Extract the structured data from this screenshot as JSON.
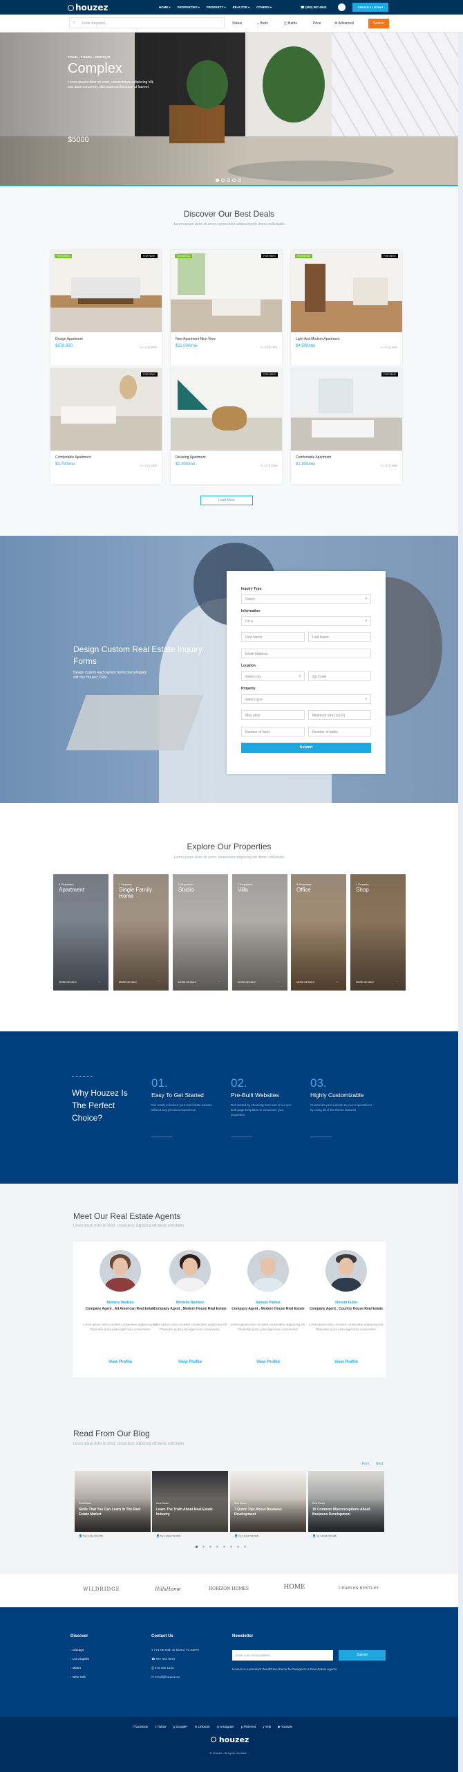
{
  "header": {
    "logo": "houzez",
    "nav": [
      "HOME",
      "PROPERTIES",
      "PROPERTY",
      "REALTOR",
      "OTHERS"
    ],
    "phone": "(800) 987 6543",
    "cta": "CREATE A LISTING",
    "search_placeholder": "Enter Keyword...",
    "filters": [
      "Status",
      "Beds",
      "Baths",
      "Price",
      "Advanced"
    ],
    "search_button": "Search"
  },
  "hero": {
    "meta": "3 Beds • 2 Baths • 2000 Sq Ft",
    "title": "Complex",
    "description": "Lorem ipsum dolor sit amet, consectetuer adipiscing elit, sed diam nonummy nibh euismod tincidunt ut laoreet",
    "price": "$5000"
  },
  "deals": {
    "title": "Discover Our Best Deals",
    "subtitle": "Lorem ipsum dolor sit amet, consectetur adipiscing elit donec sollicitudin",
    "cards": [
      {
        "badge_left": "FEATURED",
        "badge_right": "FOR RENT",
        "title": "Design Apartment",
        "price": "$876,990",
        "features": "3 ⌂ 2 ◫ 1500"
      },
      {
        "badge_left": "FEATURED",
        "badge_right": "FOR RENT",
        "title": "New Apartment Nice View",
        "price": "$11,000/mo",
        "features": "4 ⌂ 2 ◫ 1750"
      },
      {
        "badge_left": "FEATURED",
        "badge_right": "FOR RENT",
        "title": "Light And Modern Apartment",
        "price": "$4,500/mo",
        "features": "4 ⌂ 2 ◫ 1200"
      },
      {
        "badge_left": "",
        "badge_right": "FOR RENT",
        "title": "Comfortable Apartment",
        "price": "$3,700/mo",
        "features": "2 ⌂ 2 ◫ 1200"
      },
      {
        "badge_left": "",
        "badge_right": "FOR RENT",
        "title": "Relaxing Apartment",
        "price": "$2,800/mo",
        "features": "3 ⌂ 2 ◫ 1200"
      },
      {
        "badge_left": "",
        "badge_right": "FOR RENT",
        "title": "Comfortable Apartment",
        "price": "$1,800/mo",
        "features": "3 ⌂ 2 ◫ 1300"
      }
    ],
    "load_more": "Load More"
  },
  "inquiry": {
    "title": "Design Custom Real Estate Inquiry Forms",
    "description": "Design custom lead capture forms that integrate with the Houzez CRM",
    "labels": {
      "type": "Inquiry Type",
      "info": "Information",
      "location": "Location",
      "property": "Property"
    },
    "type_value": "Select",
    "info_value": "I'm a",
    "first": "First Name",
    "last": "Last Name",
    "email": "Email Address",
    "city": "Select city",
    "zip": "Zip Code",
    "ptype": "Select type",
    "maxprice": "Max price",
    "minsize": "Minimum size (Sq Ft)",
    "beds": "Number of beds",
    "baths": "Number of baths",
    "submit": "Submit"
  },
  "explore": {
    "title": "Explore Our Properties",
    "subtitle": "Lorem ipsum dolor sit amet, consectetur adipiscing elit donec sollicitudin",
    "tiles": [
      {
        "count": "5 Properties",
        "name": "Apartment",
        "link": "MORE DETAILS"
      },
      {
        "count": "1 Property",
        "name": "Single Family Home",
        "link": "MORE DETAILS"
      },
      {
        "count": "2 Properties",
        "name": "Studio",
        "link": "MORE DETAILS"
      },
      {
        "count": "2 Properties",
        "name": "Villa",
        "link": "MORE DETAILS"
      },
      {
        "count": "3 Properties",
        "name": "Office",
        "link": "MORE DETAILS"
      },
      {
        "count": "1 Property",
        "name": "Shop",
        "link": "MORE DETAILS"
      }
    ]
  },
  "why": {
    "title": "Why Houzez Is The Perfect Choice?",
    "items": [
      {
        "num": "01.",
        "title": "Easy To Get Started",
        "desc": "Get ready to launch your real estate website without any previous experience"
      },
      {
        "num": "02.",
        "title": "Pre-Built Websites",
        "desc": "Get started by choosing from one of our pre-built page templates to showcase your properties"
      },
      {
        "num": "03.",
        "title": "Highly Customizable",
        "desc": "Customize your website to your expectations by using all of the theme features"
      }
    ]
  },
  "agents": {
    "title": "Meet Our Real Estate Agents",
    "subtitle": "Lorem ipsum dolor sit amet, consectetur adipiscing elit donec sollicitudin",
    "list": [
      {
        "name": "Brittany Watkins",
        "role": "Company Agent , All American Real Estate",
        "desc": "Lorem ipsum dolor sit amet consectetur adipiscing elit. Phasellus porta justo eget risus consectetur,",
        "link": "View Profile"
      },
      {
        "name": "Michelle Ramirez",
        "role": "Company Agent , Modern House Real Estate",
        "desc": "Lorem ipsum dolor sit amet consectetur adipiscing elit. Phasellus porta justo eget risus consectetur,",
        "link": "View Profile"
      },
      {
        "name": "Samuel Palmer",
        "role": "Company Agent , Modern House Real Estate",
        "desc": "Lorem ipsum dolor sit amet consectetur adipiscing elit. Phasellus porta justo eget risus consectetur,",
        "link": "View Profile"
      },
      {
        "name": "Vincent Fuller",
        "role": "Company Agent , Country House Real Estate",
        "desc": "Lorem ipsum dolor sit amet consectetur adipiscing elit. Phasellus porta justo eget risus consectetur,",
        "link": "View Profile"
      }
    ]
  },
  "blog": {
    "title": "Read From Our Blog",
    "subtitle": "Lorem ipsum dolor sit amet, consectetur adipiscing elit donec sollicitudin",
    "prev": "Prev",
    "next": "Next",
    "posts": [
      {
        "cat": "Real Estate",
        "title": "Skills That You Can Learn In The Real Estate Market",
        "author": "by Linda Neutral"
      },
      {
        "cat": "Real Estate",
        "title": "Learn The Truth About Real Estate Industry",
        "author": "by Linda Neutral"
      },
      {
        "cat": "Real Estate",
        "title": "7 Quick Tips About Business Development",
        "author": "by Linda Neutral"
      },
      {
        "cat": "Real Estate",
        "title": "10 Common Misconceptions About Business Development",
        "author": "by Linda Neutral"
      }
    ]
  },
  "partners": [
    "WILDRIDGE",
    "HillsHome",
    "HORIZON HOMES",
    "HOME",
    "CHARLES BENTLEY"
  ],
  "footer": {
    "discover_title": "Discover",
    "discover": [
      "Chicago",
      "Los Angeles",
      "Miami",
      "New York"
    ],
    "contact_title": "Contact Us",
    "contact": [
      "774 NE 84th St Miami, FL 33879",
      "987 654 9876",
      "876 456 1349",
      "email@houzez.co"
    ],
    "newsletter_title": "Newsletter",
    "newsletter_placeholder": "Enter your email address",
    "newsletter_button": "Submit",
    "newsletter_text": "Houzez is a premium WordPress theme for Designers & Real Estate Agents.",
    "social": [
      "Facebook",
      "Twitter",
      "Google+",
      "LinkedIn",
      "Instagram",
      "Pinterest",
      "Yelp",
      "Youtube"
    ],
    "logo": "houzez",
    "copyright": "© Houzez - All rights reserved"
  },
  "colors": {
    "brand_blue": "#003f7d",
    "accent": "#1fa8e0",
    "search_orange": "#f2751a",
    "badge_green": "#77c720"
  }
}
